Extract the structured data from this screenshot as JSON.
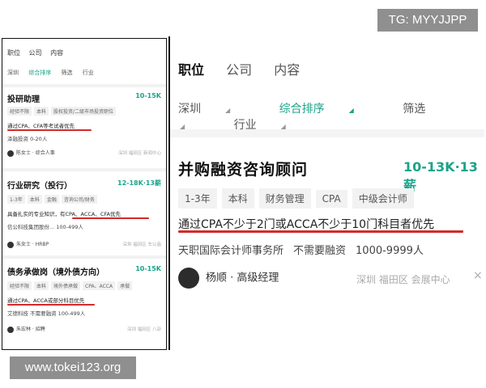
{
  "watermarks": {
    "top": "TG: MYYJJPP",
    "bottom": "www.tokei123.org"
  },
  "left": {
    "tabs": [
      "职位",
      "公司",
      "内容"
    ],
    "filters": [
      "深圳",
      "综合排序",
      "筛选",
      "行业"
    ],
    "cards": [
      {
        "title": "投研助理",
        "salary": "10-15K",
        "tags": [
          "经验不限",
          "本科",
          "股权投资/二级市场投资职位"
        ],
        "requirement": "通过CPA、CFA等考试者优先",
        "company": "泽融投资  0-20人",
        "person": "陈女士 · 综合人事",
        "location": "深圳 福田区 新闻中心"
      },
      {
        "title": "行业研究（投行）",
        "salary": "12-18K·13薪",
        "tags": [
          "1-3年",
          "本科",
          "金融",
          "咨询公司/财务"
        ],
        "requirement": "具备扎实的专业知识，有CPA、ACCA、CFA优先",
        "company": "信公科技集团股份...  100-499人",
        "person": "朱女士 · HRBP",
        "location": "深圳 福田区 车公庙"
      },
      {
        "title": "债务承做岗（境外债方向）",
        "salary": "10-15K",
        "tags": [
          "经验不限",
          "本科",
          "境外债承做",
          "CPA、ACCA",
          "承做"
        ],
        "requirement": "通过CPA、ACCA或部分科目优先",
        "company": "艾德科技  不需要融资  100-499人",
        "person": "朱宏林 · 招聘",
        "location": "深圳 福田区 八卦"
      }
    ]
  },
  "right": {
    "tabs": [
      "职位",
      "公司",
      "内容"
    ],
    "filters": [
      "深圳",
      "综合排序",
      "筛选",
      "行业"
    ],
    "job": {
      "title": "并购融资咨询顾问",
      "salary": "10-13K·13薪",
      "tags": [
        "1-3年",
        "本科",
        "财务管理",
        "CPA",
        "中级会计师"
      ],
      "requirement": "通过CPA不少于2门或ACCA不少于10门科目者优先",
      "company": [
        "天职国际会计师事务所",
        "不需要融资",
        "1000-9999人"
      ],
      "person": "杨顺 · 高级经理",
      "location": "深圳 福田区 会展中心",
      "close_icon": "×"
    }
  },
  "colors": {
    "accent": "#1aa38a",
    "underline": "#d32a2a"
  }
}
